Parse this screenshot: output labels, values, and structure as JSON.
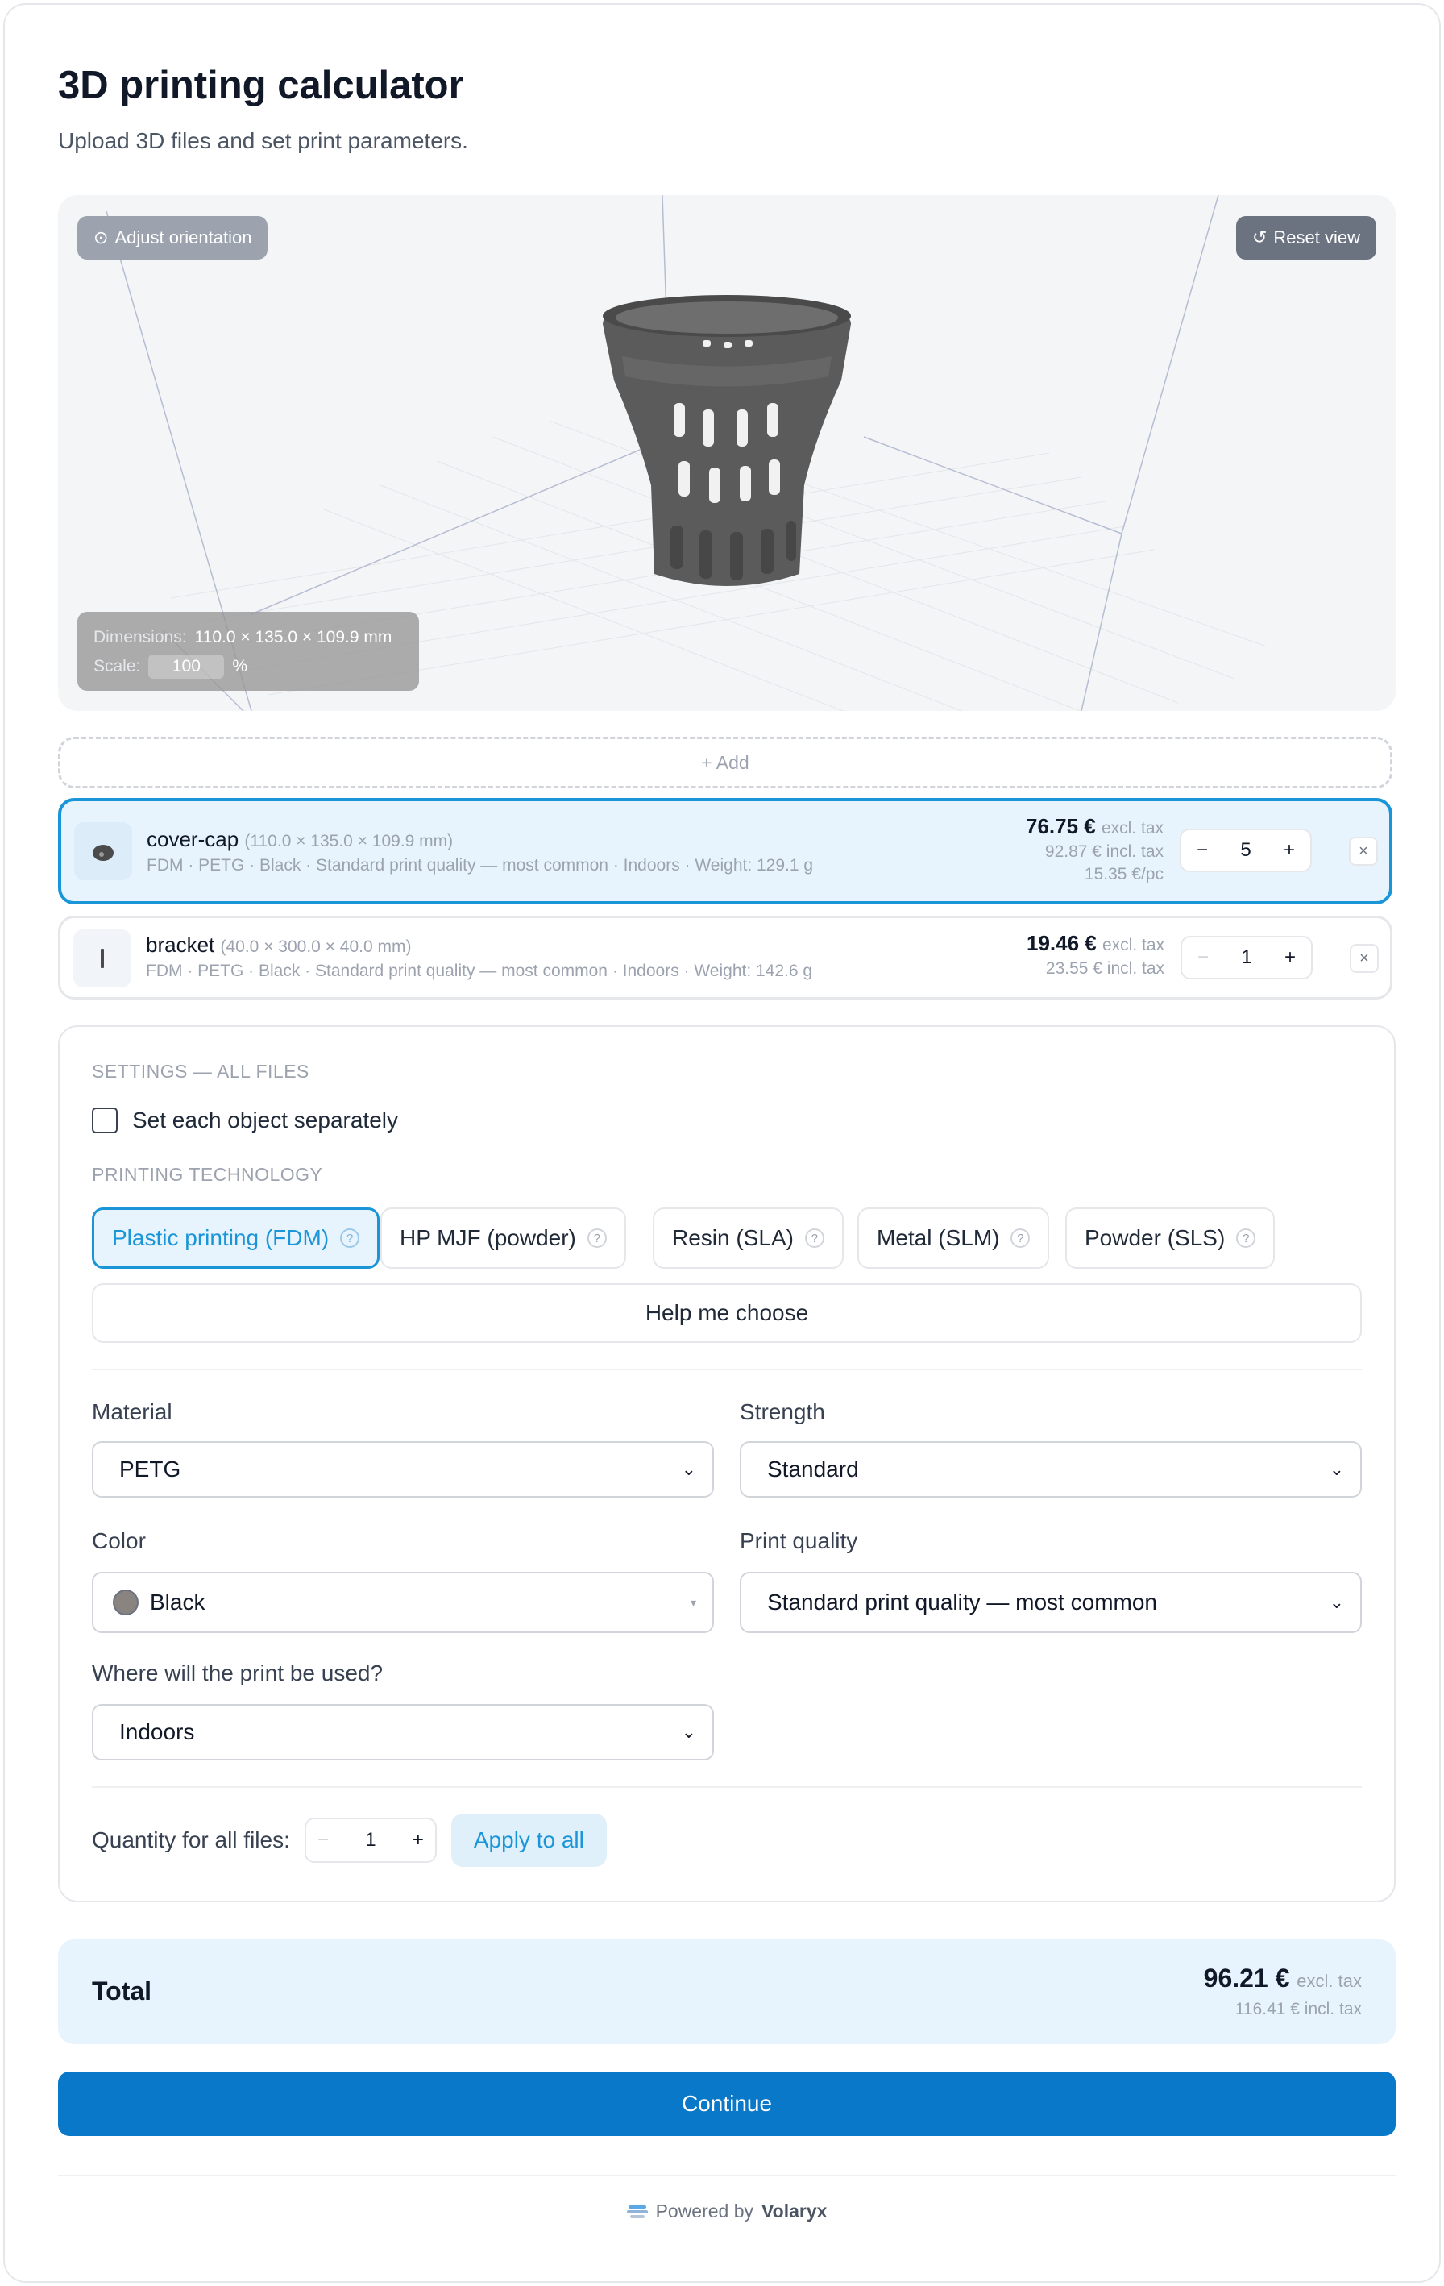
{
  "page": {
    "title": "3D printing calculator",
    "subtitle": "Upload 3D files and set print parameters."
  },
  "viewer": {
    "adjust_orientation": "Adjust orientation",
    "reset_view": "Reset view",
    "dimensions_label": "Dimensions:",
    "dimensions_value": "110.0 × 135.0 × 109.9 mm",
    "scale_label": "Scale:",
    "scale_value": "100",
    "scale_unit": "%"
  },
  "add_label": "+ Add",
  "files": [
    {
      "name": "cover-cap",
      "dims": "(110.0 × 135.0 × 109.9 mm)",
      "meta": "FDM · PETG · Black · Standard print quality — most common · Indoors · Weight: 129.1 g",
      "price_excl": "76.75 €",
      "excl_label": "excl. tax",
      "price_incl": "92.87 € incl. tax",
      "per_piece": "15.35 €/pc",
      "quantity": "5",
      "selected": true
    },
    {
      "name": "bracket",
      "dims": "(40.0 × 300.0 × 40.0 mm)",
      "meta": "FDM · PETG · Black · Standard print quality — most common · Indoors · Weight: 142.6 g",
      "price_excl": "19.46 €",
      "excl_label": "excl. tax",
      "price_incl": "23.55 € incl. tax",
      "quantity": "1",
      "selected": false
    }
  ],
  "stepper": {
    "minus": "−",
    "plus": "+",
    "remove": "×"
  },
  "settings": {
    "section_title": "SETTINGS — ALL FILES",
    "separately_label": "Set each object separately",
    "technology_title": "PRINTING TECHNOLOGY",
    "technologies": [
      {
        "label": "Plastic printing (FDM)",
        "active": true
      },
      {
        "label": "HP MJF (powder)",
        "active": false
      },
      {
        "label": "Resin (SLA)",
        "active": false
      },
      {
        "label": "Metal (SLM)",
        "active": false
      },
      {
        "label": "Powder (SLS)",
        "active": false
      }
    ],
    "help_label": "Help me choose",
    "material_label": "Material",
    "material_value": "PETG",
    "strength_label": "Strength",
    "strength_value": "Standard",
    "color_label": "Color",
    "color_value": "Black",
    "color_hex": "#8a8480",
    "quality_label": "Print quality",
    "quality_value": "Standard print quality — most common",
    "usage_label": "Where will the print be used?",
    "usage_value": "Indoors",
    "qty_all_label": "Quantity for all files:",
    "qty_all_value": "1",
    "apply_label": "Apply to all"
  },
  "total": {
    "label": "Total",
    "price_excl": "96.21 €",
    "excl_label": "excl. tax",
    "price_incl": "116.41 € incl. tax"
  },
  "continue_label": "Continue",
  "footer": {
    "powered_by": "Powered by",
    "brand": "Volaryx"
  },
  "colors": {
    "accent": "#1a96d8",
    "primary_button": "#0a78c8",
    "selected_bg": "#e8f4fd"
  },
  "icons": [
    "orientation-icon",
    "reset-icon",
    "question-icon",
    "caret-down-icon",
    "close-icon",
    "brand-logo-icon"
  ]
}
